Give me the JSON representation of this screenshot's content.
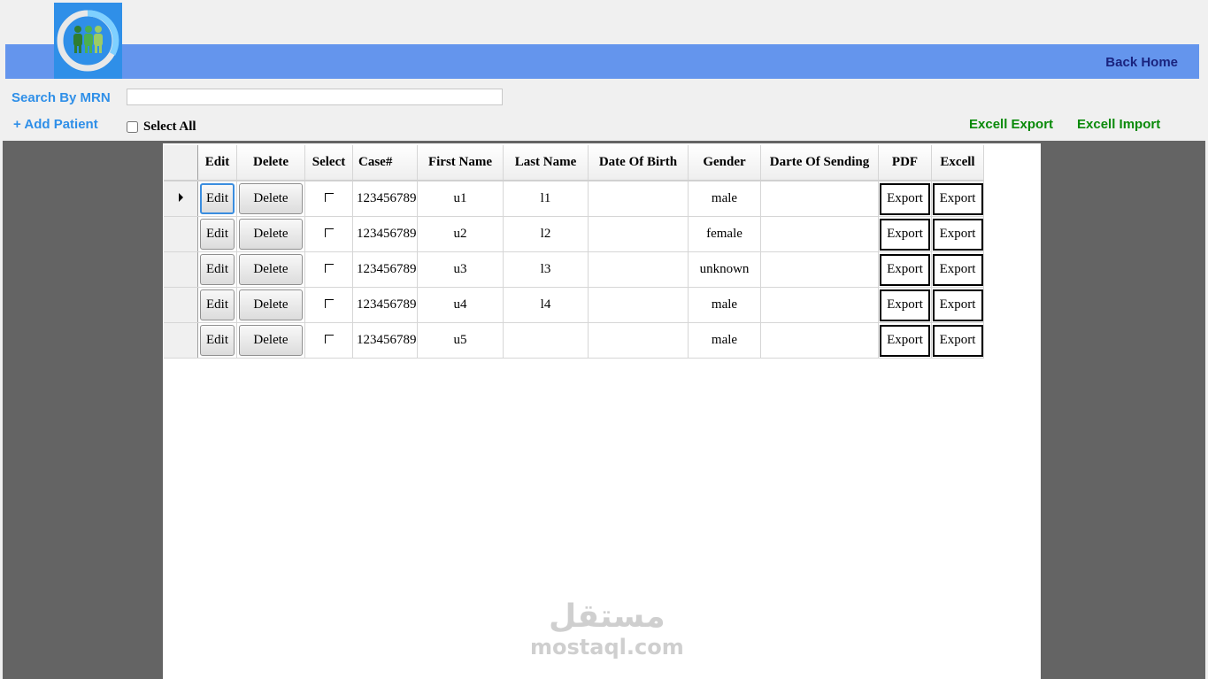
{
  "header": {
    "logo_icon": "people-logo-icon",
    "back_home": "Back Home",
    "bar_color": "#6495ed"
  },
  "toolbar": {
    "search_label": "Search By MRN",
    "search_value": "",
    "add_patient": "+ Add Patient",
    "select_all": "Select All",
    "excel_export": "Excell Export",
    "excel_import": "Excell Import"
  },
  "grid": {
    "columns": [
      "Edit",
      "Delete",
      "Select",
      "Case#",
      "First Name",
      "Last Name",
      "Date Of Birth",
      "Gender",
      "Darte Of Sending",
      "PDF",
      "Excell"
    ],
    "button_labels": {
      "edit": "Edit",
      "delete": "Delete",
      "export": "Export"
    },
    "rows": [
      {
        "case": "123456789",
        "first": "u1",
        "last": "l1",
        "dob": "",
        "gender": "male",
        "sending": ""
      },
      {
        "case": "123456789",
        "first": "u2",
        "last": "l2",
        "dob": "",
        "gender": "female",
        "sending": ""
      },
      {
        "case": "123456789",
        "first": "u3",
        "last": "l3",
        "dob": "",
        "gender": "unknown",
        "sending": ""
      },
      {
        "case": "123456789",
        "first": "u4",
        "last": "l4",
        "dob": "",
        "gender": "male",
        "sending": ""
      },
      {
        "case": "123456789",
        "first": "u5",
        "last": "",
        "dob": "",
        "gender": "male",
        "sending": ""
      }
    ]
  },
  "watermark": {
    "arabic": "مستقل",
    "latin": "mostaql.com"
  }
}
